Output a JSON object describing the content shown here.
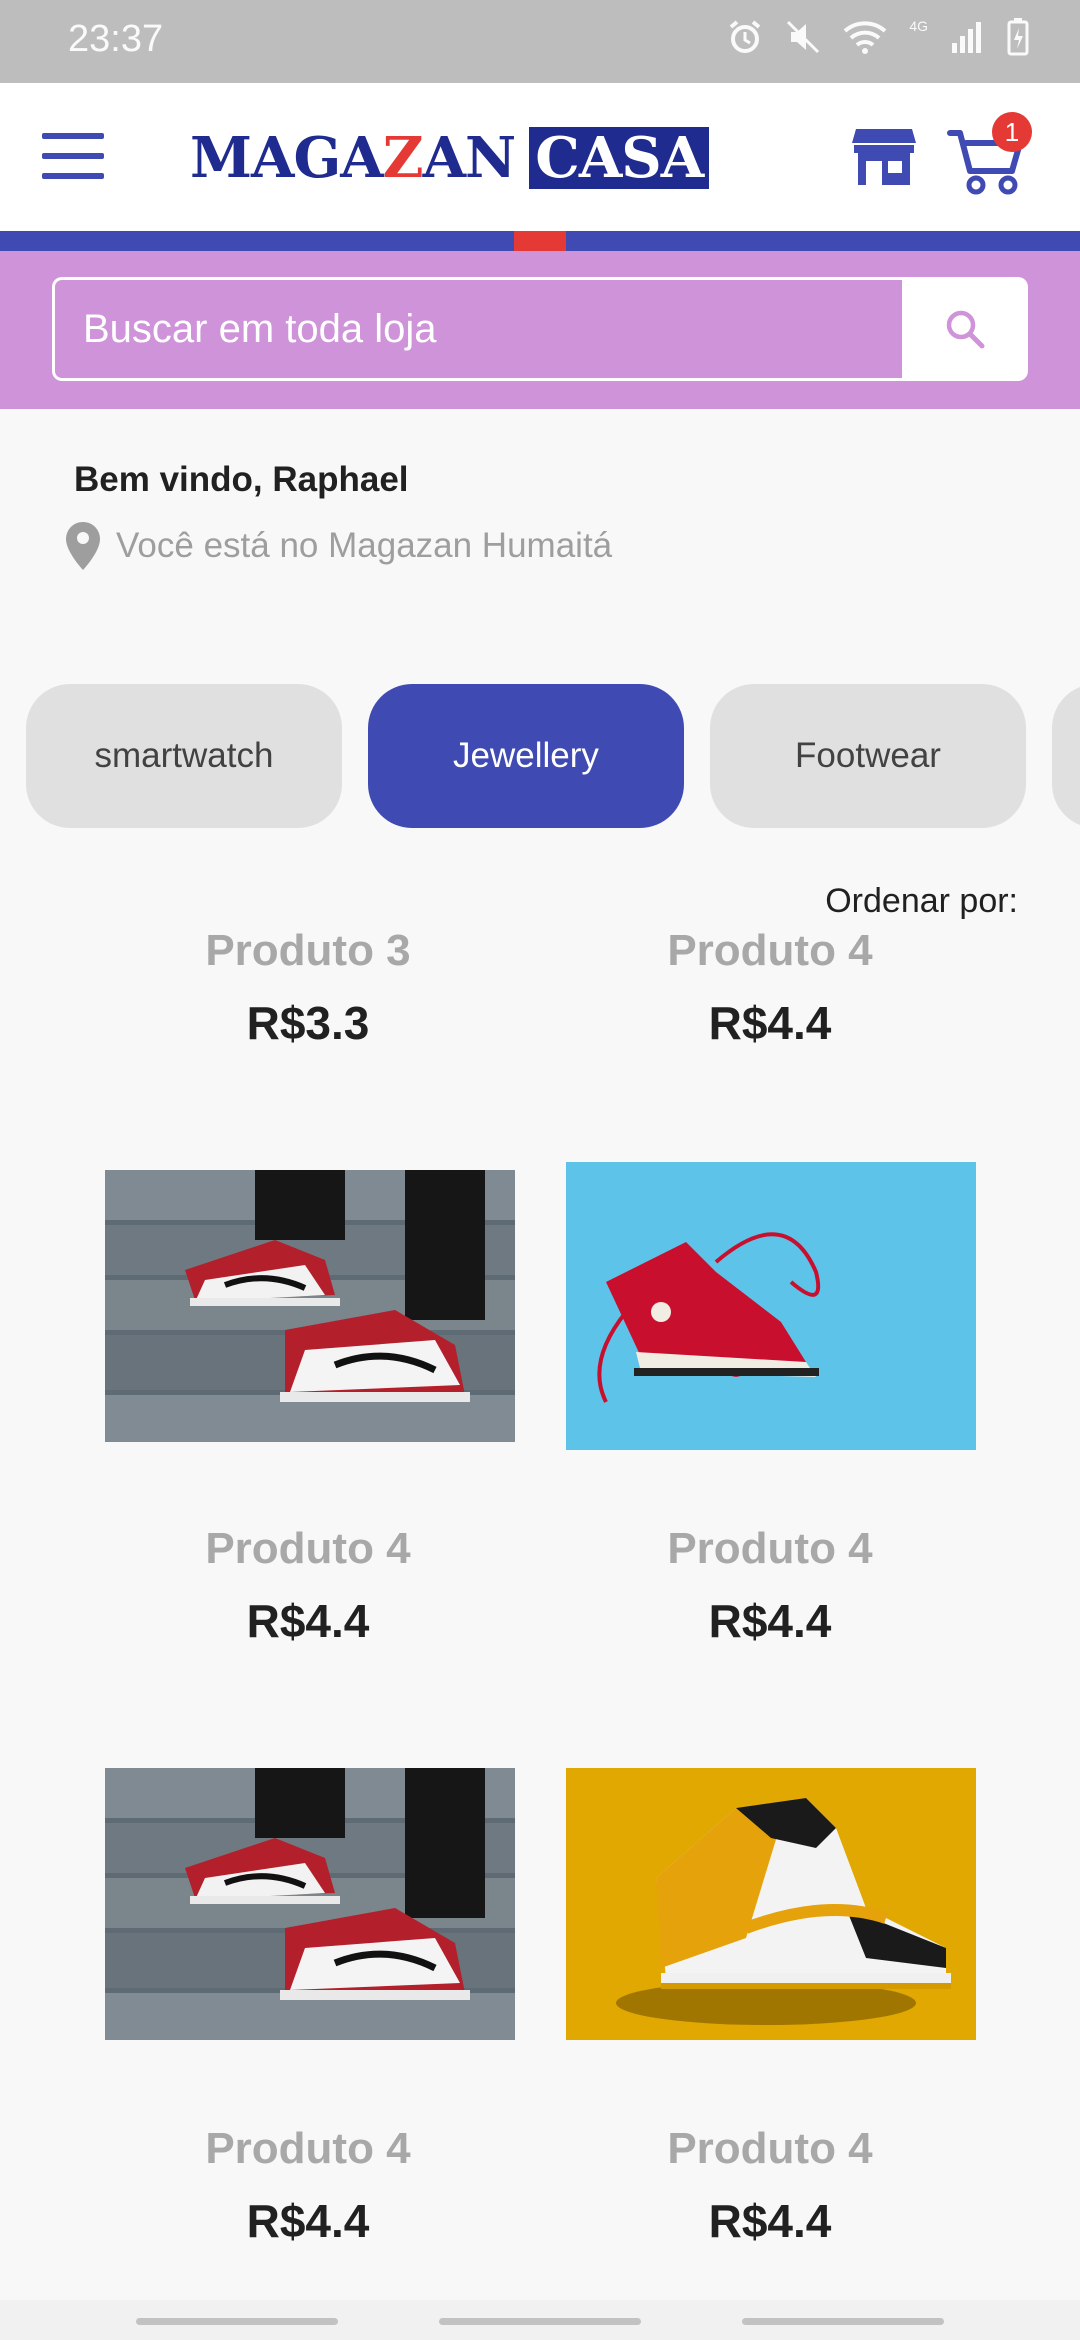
{
  "status_bar": {
    "time": "23:37",
    "network": "4G"
  },
  "header": {
    "logo_part1_a": "MAGA",
    "logo_part1_z": "Z",
    "logo_part1_b": "AN",
    "logo_part2": "CASA",
    "cart_count": "1",
    "brand_colors": {
      "primary": "#3f4bb3",
      "accent": "#e53935",
      "search_band": "#ce93d8"
    }
  },
  "search": {
    "placeholder": "Buscar em toda loja"
  },
  "welcome": {
    "greeting": "Bem vindo, Raphael",
    "location": "Você está no Magazan Humaitá"
  },
  "categories": [
    {
      "label": "smartwatch",
      "active": false
    },
    {
      "label": "Jewellery",
      "active": true
    },
    {
      "label": "Footwear",
      "active": false
    }
  ],
  "sort": {
    "label": "Ordenar por:"
  },
  "products": [
    {
      "name": "Produto 3",
      "price": "R$3.3"
    },
    {
      "name": "Produto 4",
      "price": "R$4.4"
    },
    {
      "name": "Produto 4",
      "price": "R$4.4",
      "image": "red-sneakers-stairs"
    },
    {
      "name": "Produto 4",
      "price": "R$4.4",
      "image": "red-hightop-blue-background"
    },
    {
      "name": "Produto 4",
      "price": "R$4.4",
      "image": "red-sneakers-stairs"
    },
    {
      "name": "Produto 4",
      "price": "R$4.4",
      "image": "yellow-sneaker-yellow-background"
    }
  ]
}
